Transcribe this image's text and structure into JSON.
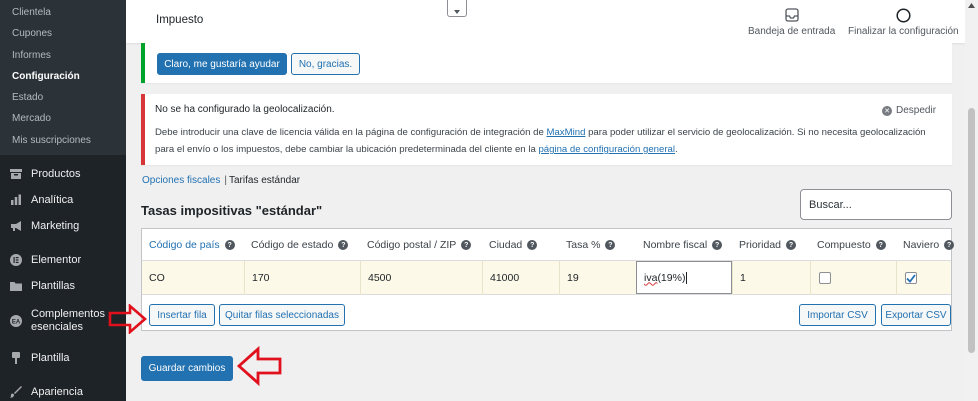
{
  "sidebar": {
    "submenu": [
      "Clientela",
      "Cupones",
      "Informes",
      "Configuración",
      "Estado",
      "Mercado",
      "Mis suscripciones"
    ],
    "current_submenu": "Configuración",
    "menu": [
      {
        "label": "Productos",
        "icon": "archive-icon"
      },
      {
        "label": "Analítica",
        "icon": "bar-chart-icon"
      },
      {
        "label": "Marketing",
        "icon": "megaphone-icon"
      },
      {
        "label": "Elementor",
        "icon": "elementor-icon"
      },
      {
        "label": "Plantillas",
        "icon": "folder-icon"
      },
      {
        "label": "Complementos esenciales",
        "icon": "ea-icon"
      },
      {
        "label": "Plantilla",
        "icon": "brush-icon"
      },
      {
        "label": "Apariencia",
        "icon": "paintbrush-icon"
      }
    ]
  },
  "header": {
    "title": "Impuesto",
    "inbox_label": "Bandeja de entrada",
    "finish_label": "Finalizar la configuración"
  },
  "help_notice": {
    "yes_label": "Claro, me gustaría ayudar",
    "no_label": "No, gracias."
  },
  "geo_notice": {
    "title": "No se ha configurado la geolocalización.",
    "dismiss_label": "Despedir",
    "text_1": "Debe introducir una clave de licencia válida en la página de configuración de integración de ",
    "link_1": "MaxMind",
    "text_2": " para poder utilizar el servicio de geolocalización. Si no necesita geolocalización para el envío o los impuestos, debe cambiar la ubicación predeterminada del cliente en la ",
    "link_2": "página de configuración general",
    "text_3": "."
  },
  "subsub": {
    "link": "Opciones fiscales",
    "separator": "|",
    "current": "Tarifas estándar"
  },
  "section_title": "Tasas impositivas \"estándar\"",
  "search": {
    "placeholder": "Buscar..."
  },
  "table": {
    "columns": [
      "Código de país",
      "Código de estado",
      "Código postal / ZIP",
      "Ciudad",
      "Tasa %",
      "Nombre fiscal",
      "Prioridad",
      "Compuesto",
      "Naviero"
    ],
    "row": {
      "country": "CO",
      "state": "170",
      "postcode": "4500",
      "city": "41000",
      "rate": "19",
      "name_underlined": "iva",
      "name_rest": "(19%)",
      "priority": "1",
      "compound": false,
      "shipping": true
    }
  },
  "buttons": {
    "insert_row": "Insertar fila",
    "remove_rows": "Quitar filas seleccionadas",
    "import_csv": "Importar CSV",
    "export_csv": "Exportar CSV",
    "save": "Guardar cambios"
  },
  "colors": {
    "accent": "#2271b1",
    "annotation": "#e0101c",
    "sidebar_bg": "#1d2327",
    "row_highlight": "#fcf9e8"
  }
}
